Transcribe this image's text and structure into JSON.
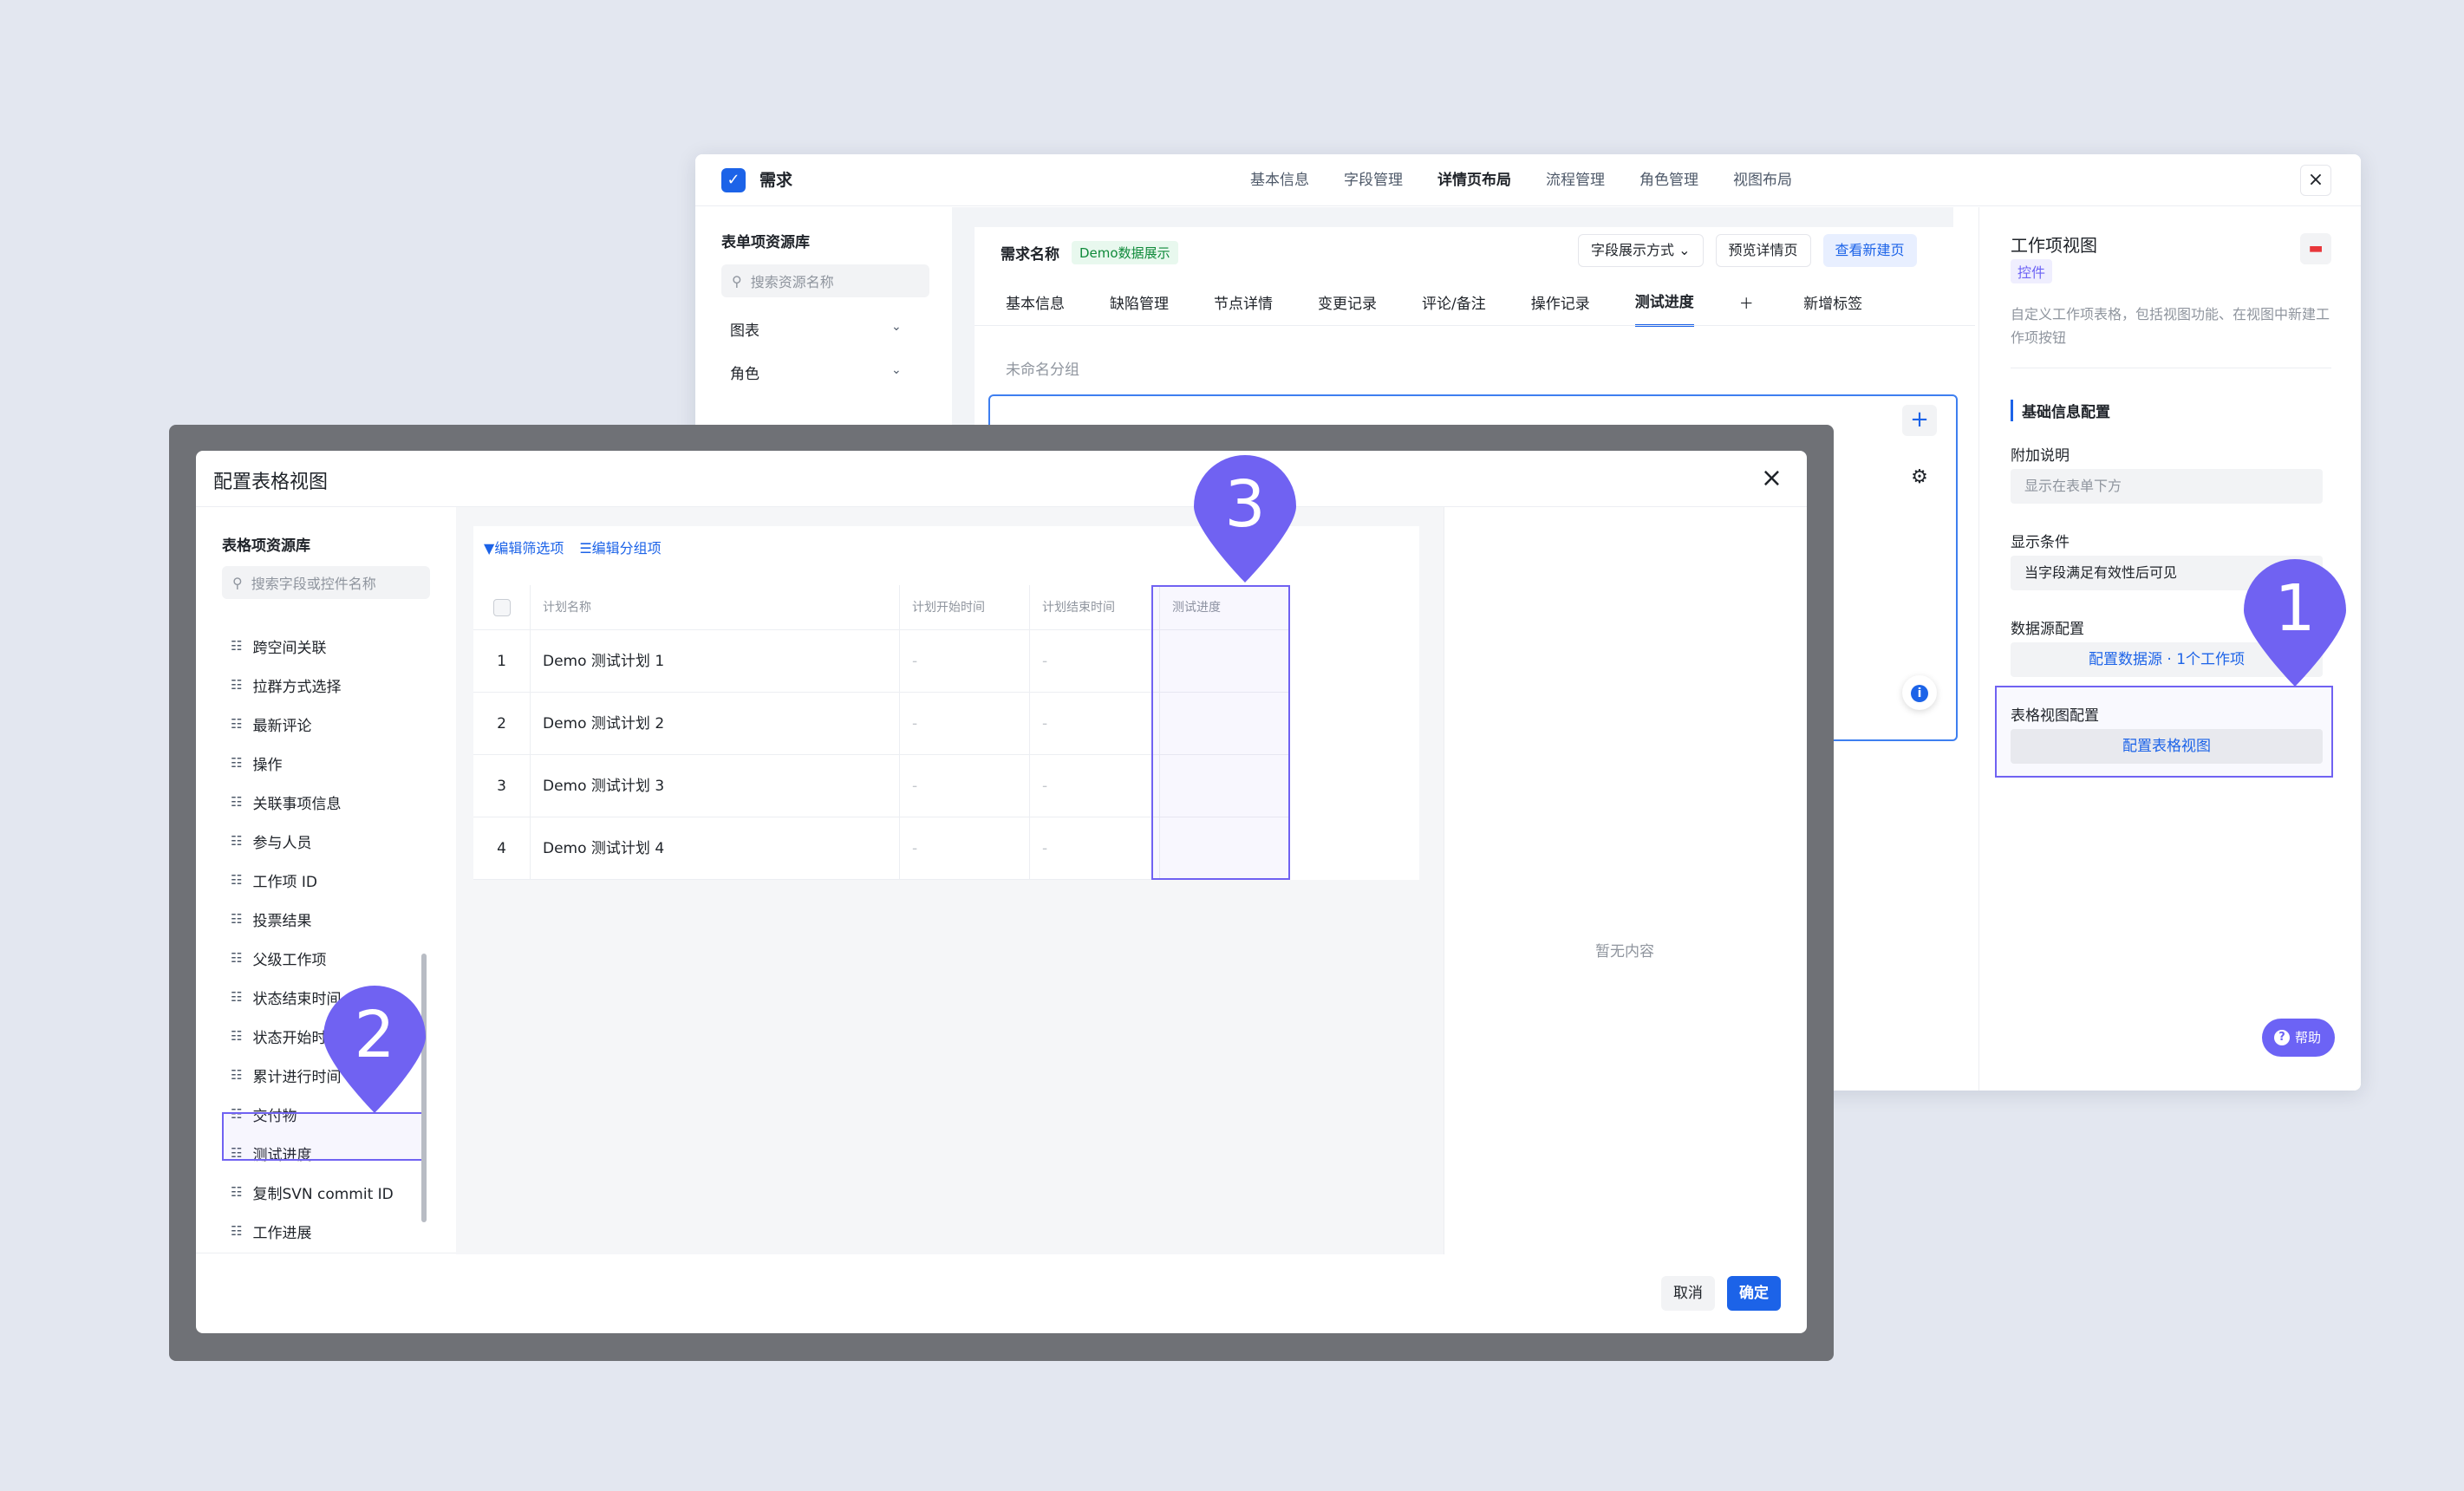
{
  "back": {
    "app_icon": "check-circle-icon",
    "app_title": "需求",
    "nav": [
      "基本信息",
      "字段管理",
      "详情页布局",
      "流程管理",
      "角色管理",
      "视图布局"
    ],
    "nav_active": "详情页布局",
    "library_title": "表单项资源库",
    "search_placeholder": "搜索资源名称",
    "accordions": [
      "图表",
      "角色"
    ],
    "name_label": "需求名称",
    "demo_tag": "Demo数据展示",
    "field_display_btn": "字段展示方式",
    "preview_btn": "预览详情页",
    "new_page_btn": "查看新建页",
    "tabs": [
      "基本信息",
      "缺陷管理",
      "节点详情",
      "变更记录",
      "评论/备注",
      "操作记录",
      "测试进度",
      "新增标签"
    ],
    "active_tab": "测试进度",
    "group_placeholder": "未命名分组",
    "panel": {
      "title": "工作项视图",
      "badge": "控件",
      "desc": "自定义工作项表格，包括视图功能、在视图中新建工作项按钮",
      "section": "基础信息配置",
      "extra_label": "附加说明",
      "extra_placeholder": "显示在表单下方",
      "cond_label": "显示条件",
      "cond_value": "当字段满足有效性后可见",
      "source_label": "数据源配置",
      "source_value": "配置数据源 · 1个工作项",
      "table_label": "表格视图配置",
      "table_value": "配置表格视图",
      "help": "帮助"
    }
  },
  "dialog": {
    "title": "配置表格视图",
    "library_title": "表格项资源库",
    "search_placeholder": "搜索字段或控件名称",
    "items": [
      "跨空间关联",
      "拉群方式选择",
      "最新评论",
      "操作",
      "关联事项信息",
      "参与人员",
      "工作项 ID",
      "投票结果",
      "父级工作项",
      "状态结束时间",
      "状态开始时间",
      "累计进行时间",
      "交付物",
      "测试进度",
      "复制SVN commit ID",
      "工作进展"
    ],
    "selected_item": "测试进度",
    "toolbar": {
      "filter": "编辑筛选项",
      "group": "编辑分组项"
    },
    "columns": [
      "计划名称",
      "计划开始时间",
      "计划结束时间",
      "测试进度"
    ],
    "rows": [
      {
        "no": "1",
        "name": "Demo 测试计划 1",
        "start": "-",
        "end": "-"
      },
      {
        "no": "2",
        "name": "Demo 测试计划 2",
        "start": "-",
        "end": "-"
      },
      {
        "no": "3",
        "name": "Demo 测试计划 3",
        "start": "-",
        "end": "-"
      },
      {
        "no": "4",
        "name": "Demo 测试计划 4",
        "start": "-",
        "end": "-"
      }
    ],
    "empty_preview": "暂无内容",
    "cancel": "取消",
    "ok": "确定"
  },
  "pins": {
    "one": "1",
    "two": "2",
    "three": "3",
    "color": "#7062f2"
  }
}
